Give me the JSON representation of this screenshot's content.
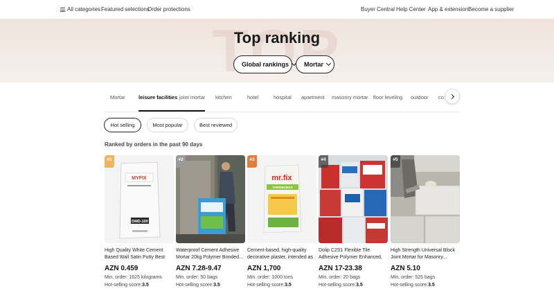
{
  "topnav": {
    "all_categories": "All categories",
    "featured": "Featured selections",
    "protections": "Order protections",
    "buyer_central": "Buyer Central",
    "help_center": "Help Center",
    "app_extension": "App & extension",
    "become_supplier": "Become a supplier"
  },
  "hero": {
    "title": "Top ranking",
    "watermark": "TOP",
    "region_filter": "Global rankings",
    "category_filter": "Mortar"
  },
  "tabs": [
    "Mortar",
    "leisure facilities",
    "joint mortar",
    "kitchen",
    "hotel",
    "hospital",
    "apartment",
    "masonry mortar",
    "floor leveling",
    "outdoor",
    "co"
  ],
  "active_tab": "leisure facilities",
  "sort": {
    "hot": "Hot selling",
    "popular": "Most popular",
    "reviewed": "Best reviewed",
    "active": "Hot selling"
  },
  "subtitle": "Ranked by orders in the past 90 days",
  "products": [
    {
      "rank": "#1",
      "title": "High Quality White Cement Based Wall Satin Putty Best Price...",
      "price": "AZN 0.459",
      "moq": "Min. order: 1625 kilograms",
      "score_label": "Hot-selling score:",
      "score": "3.5",
      "bag_brand": "MYFIX",
      "bag_code": "DMD-100"
    },
    {
      "rank": "#2",
      "title": "Waterproof Cement Adhesive Mortar 20kg Polymer Bonded...",
      "price": "AZN 7.28-9.47",
      "moq": "Min. order: 50 bags",
      "score_label": "Hot-selling score:",
      "score": "3.5"
    },
    {
      "rank": "#3",
      "title": "Cement-based, high-quality decorative plaster, intended as a...",
      "price": "AZN 1,700",
      "moq": "Min. order: 1000 tons",
      "score_label": "Hot-selling score:",
      "score": "3.5",
      "bag_brand": "mr.fix",
      "bag_label": "THERMOMAX"
    },
    {
      "rank": "#4",
      "title": "Dolip C2S1 Flexible Tile Adhesive Polymer Enhanced, Waterproof...",
      "price": "AZN 17-23.38",
      "moq": "Min. order: 20 bags",
      "score_label": "Hot-selling score:",
      "score": "3.5"
    },
    {
      "rank": "#5",
      "title": "High Strength Universal Block Joint Mortar for Masonry...",
      "price": "AZN 5.10",
      "moq": "Min. order: 525 bags",
      "score_label": "Hot-selling score:",
      "score": "3.5"
    }
  ],
  "colors": {
    "hero_bg": "#efe3dc",
    "text": "#222222",
    "rank1": "#f0b35e",
    "rank2": "#9a9a9a",
    "rank3": "#e27d3c"
  }
}
